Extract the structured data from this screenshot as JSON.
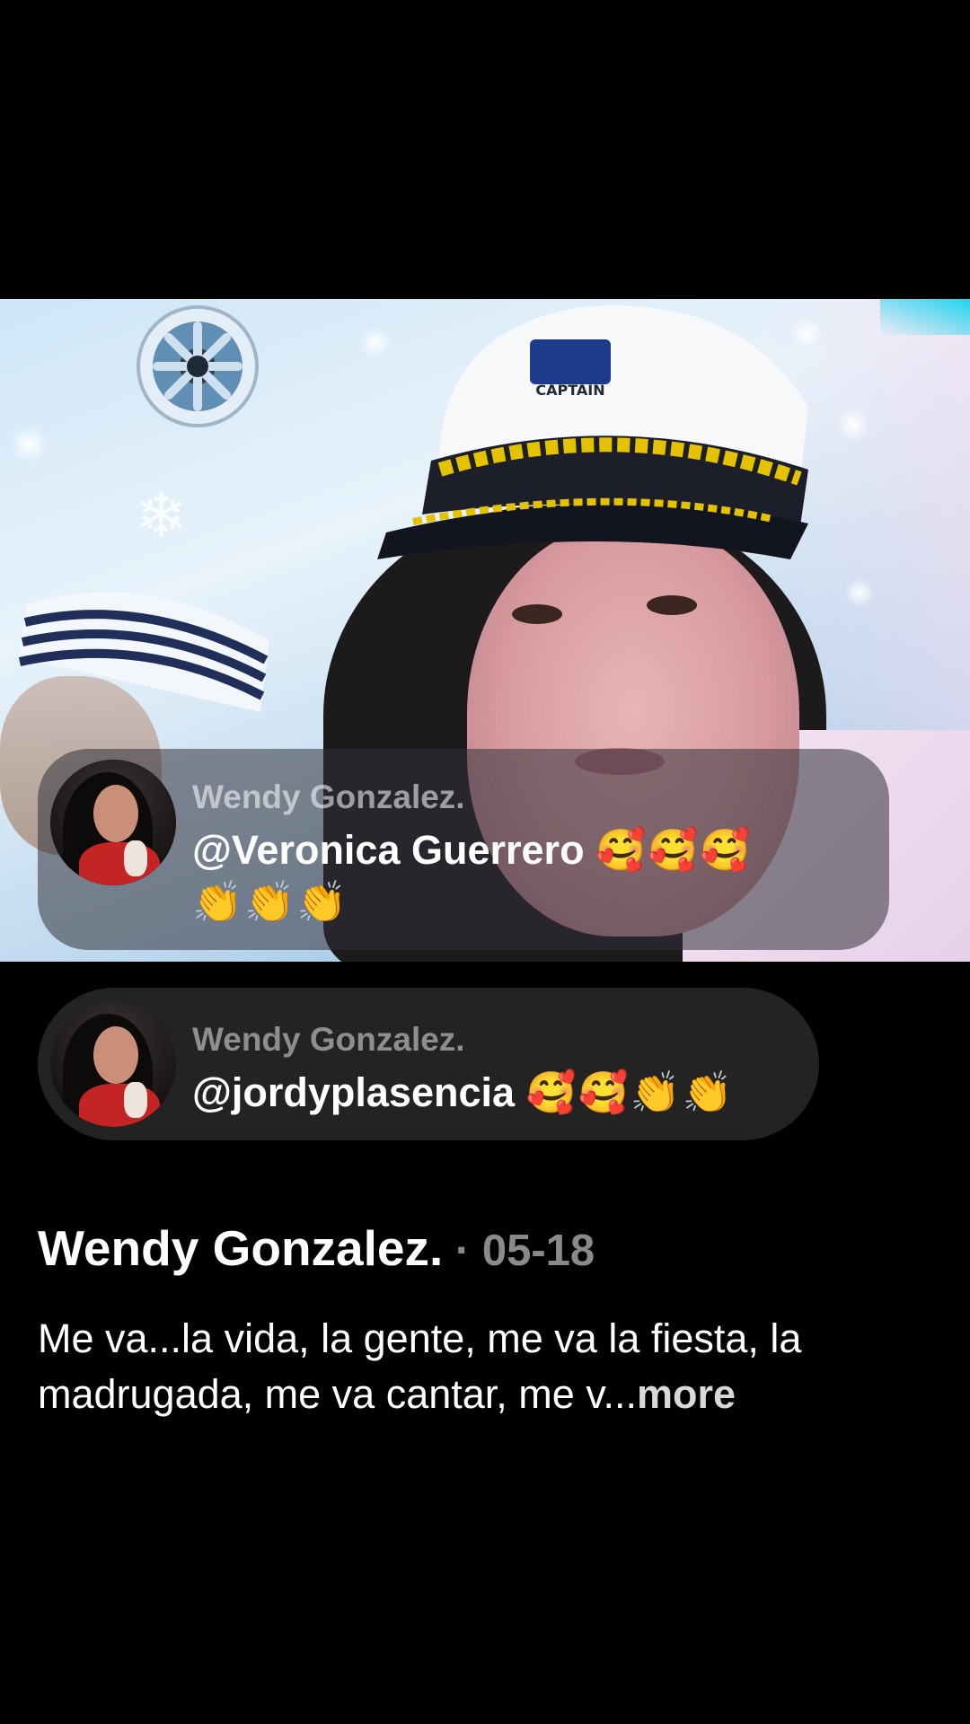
{
  "video": {
    "hat_label": "CAPTAIN"
  },
  "comments": [
    {
      "author": "Wendy Gonzalez.",
      "mention": "@Veronica Guerrero",
      "emoji_line1": "🥰🥰🥰",
      "emoji_line2": "👏👏👏",
      "avatar_icon": "profile-photo"
    },
    {
      "author": "Wendy Gonzalez.",
      "mention": "@jordyplasencia",
      "emojis": "🥰🥰👏👏",
      "avatar_icon": "profile-photo"
    }
  ],
  "post": {
    "author": "Wendy Gonzalez.",
    "separator": " · ",
    "date": "05-18",
    "description": "Me va...la vida, la gente, me va la fiesta, la madrugada, me va cantar, me v...",
    "more_label": "more"
  },
  "colors": {
    "background": "#000000",
    "muted_text": "#8a8a8a",
    "bubble_dark": "#232323"
  }
}
